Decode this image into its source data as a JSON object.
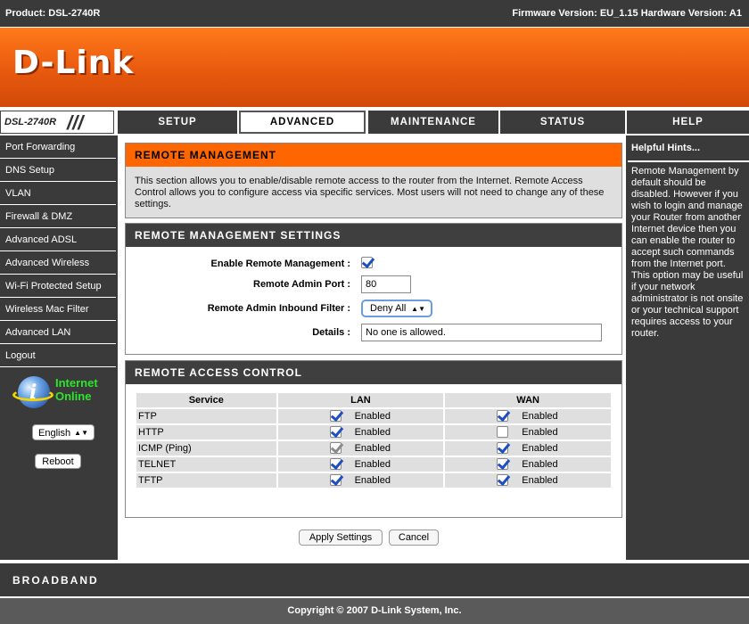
{
  "topbar": {
    "product": "Product: DSL-2740R",
    "firmware": "Firmware Version: EU_1.15 Hardware Version: A1"
  },
  "brand": {
    "logo": "D-Link"
  },
  "nav": {
    "model": "DSL-2740R",
    "tabs": [
      {
        "label": "SETUP",
        "active": false
      },
      {
        "label": "ADVANCED",
        "active": true
      },
      {
        "label": "MAINTENANCE",
        "active": false
      },
      {
        "label": "STATUS",
        "active": false
      },
      {
        "label": "HELP",
        "active": false
      }
    ]
  },
  "sidebar": {
    "items": [
      {
        "label": "Port Forwarding"
      },
      {
        "label": "DNS Setup"
      },
      {
        "label": "VLAN"
      },
      {
        "label": "Firewall & DMZ"
      },
      {
        "label": "Advanced ADSL"
      },
      {
        "label": "Advanced Wireless"
      },
      {
        "label": "Wi-Fi Protected Setup"
      },
      {
        "label": "Wireless Mac Filter"
      },
      {
        "label": "Advanced LAN"
      },
      {
        "label": "Logout"
      }
    ],
    "status_line1": "Internet",
    "status_line2": "Online",
    "language": "English",
    "reboot_label": "Reboot"
  },
  "remote_management": {
    "title": "REMOTE MANAGEMENT",
    "description": "This section allows you to enable/disable remote access to the router from the Internet. Remote Access Control allows you to configure access via specific services. Most users will not need to change any of these settings."
  },
  "settings": {
    "title": "REMOTE MANAGEMENT SETTINGS",
    "enable_label": "Enable Remote Management :",
    "enable_checked": true,
    "port_label": "Remote Admin Port :",
    "port_value": "80",
    "filter_label": "Remote Admin Inbound Filter :",
    "filter_value": "Deny All",
    "details_label": "Details :",
    "details_value": "No one is allowed."
  },
  "access_control": {
    "title": "REMOTE ACCESS CONTROL",
    "headers": {
      "service": "Service",
      "lan": "LAN",
      "wan": "WAN"
    },
    "rows": [
      {
        "service": "FTP",
        "lan_checked": true,
        "lan_disabled": false,
        "lan_label": "Enabled",
        "wan_checked": true,
        "wan_label": "Enabled"
      },
      {
        "service": "HTTP",
        "lan_checked": true,
        "lan_disabled": false,
        "lan_label": "Enabled",
        "wan_checked": false,
        "wan_label": "Enabled"
      },
      {
        "service": "ICMP (Ping)",
        "lan_checked": true,
        "lan_disabled": true,
        "lan_label": "Enabled",
        "wan_checked": true,
        "wan_label": "Enabled"
      },
      {
        "service": "TELNET",
        "lan_checked": true,
        "lan_disabled": false,
        "lan_label": "Enabled",
        "wan_checked": true,
        "wan_label": "Enabled"
      },
      {
        "service": "TFTP",
        "lan_checked": true,
        "lan_disabled": false,
        "lan_label": "Enabled",
        "wan_checked": true,
        "wan_label": "Enabled"
      }
    ]
  },
  "actions": {
    "apply_label": "Apply Settings",
    "cancel_label": "Cancel"
  },
  "hints": {
    "title": "Helpful Hints...",
    "text": "Remote Management by default should be disabled. However if you wish to login and manage your Router from another Internet device then you can enable the router to accept such commands from the Internet port. This option may be useful if your network administrator is not onsite or your technical support requires access to your router."
  },
  "footer": {
    "broadband": "BROADBAND",
    "copyright": "Copyright © 2007 D-Link System, Inc."
  },
  "colors": {
    "accent": "#ff6600",
    "dark": "#3a3a3a",
    "check": "#1e4fbf"
  }
}
